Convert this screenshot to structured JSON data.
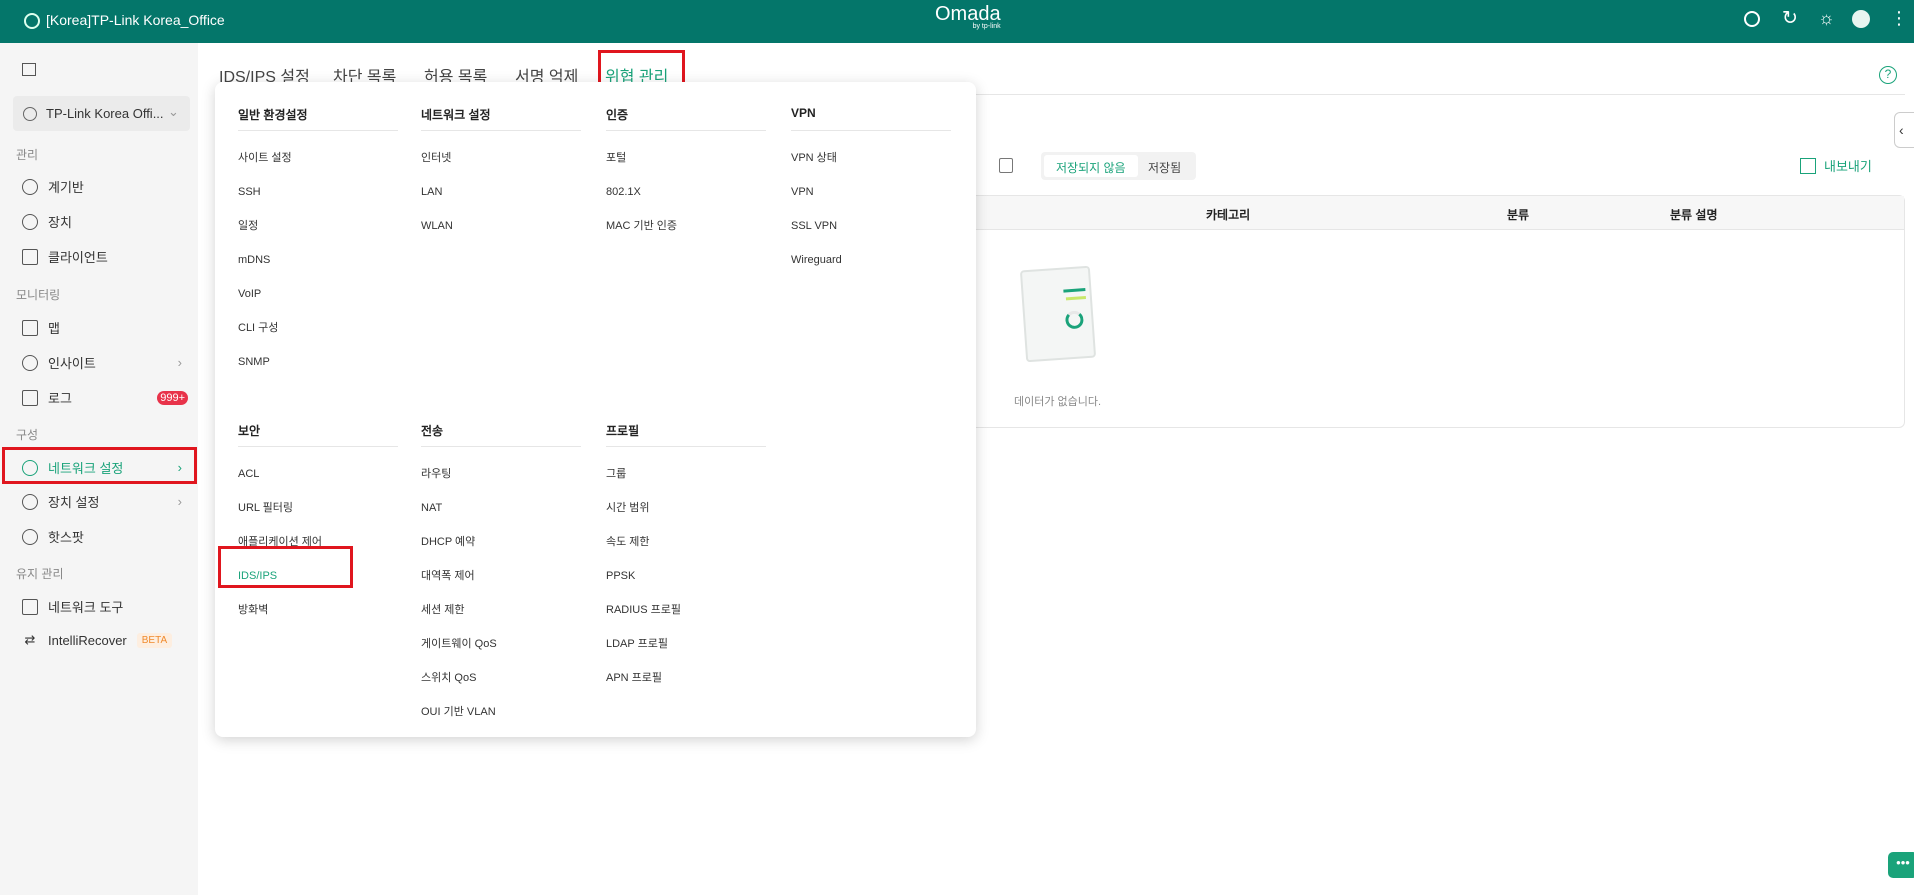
{
  "header": {
    "site_title": "[Korea]TP-Link Korea_Office",
    "logo": "Omada",
    "logo_sub": "by tp-link",
    "icons": [
      "search-icon",
      "refresh-icon",
      "theme-icon",
      "avatar",
      "more-icon"
    ]
  },
  "sidebar": {
    "site_selector": "TP-Link Korea Offi...",
    "sections": [
      {
        "label": "관리",
        "items": [
          {
            "label": "계기반",
            "icon": "dashboard-icon"
          },
          {
            "label": "장치",
            "icon": "device-icon"
          },
          {
            "label": "클라이언트",
            "icon": "client-icon"
          }
        ]
      },
      {
        "label": "모니터링",
        "items": [
          {
            "label": "맵",
            "icon": "map-icon"
          },
          {
            "label": "인사이트",
            "icon": "insight-icon"
          },
          {
            "label": "로그",
            "icon": "log-icon",
            "badge": "999+"
          }
        ]
      },
      {
        "label": "구성",
        "items": [
          {
            "label": "네트워크 설정",
            "icon": "globe-icon",
            "active": true
          },
          {
            "label": "장치 설정",
            "icon": "device-settings-icon"
          },
          {
            "label": "핫스팟",
            "icon": "hotspot-icon"
          }
        ]
      },
      {
        "label": "유지 관리",
        "items": [
          {
            "label": "네트워크 도구",
            "icon": "toolbox-icon"
          },
          {
            "label": "IntelliRecover",
            "icon": "recover-icon",
            "badge": "BETA"
          }
        ]
      }
    ]
  },
  "tabs": [
    {
      "label": "IDS/IPS 설정"
    },
    {
      "label": "차단 목록"
    },
    {
      "label": "허용 목록"
    },
    {
      "label": "서명 억제"
    },
    {
      "label": "위협 관리",
      "active": true
    }
  ],
  "menu": {
    "columns": [
      {
        "title": "일반 환경설정",
        "items": [
          "사이트 설정",
          "SSH",
          "일정",
          "mDNS",
          "VoIP",
          "CLI 구성",
          "SNMP"
        ]
      },
      {
        "title": "네트워크 설정",
        "items": [
          "인터넷",
          "LAN",
          "WLAN"
        ]
      },
      {
        "title": "인증",
        "items": [
          "포털",
          "802.1X",
          "MAC 기반 인증"
        ]
      },
      {
        "title": "VPN",
        "items": [
          "VPN 상태",
          "VPN",
          "SSL VPN",
          "Wireguard"
        ]
      },
      {
        "title": "보안",
        "items": [
          "ACL",
          "URL 필터링",
          "애플리케이션 제어",
          "IDS/IPS",
          "방화벽"
        ]
      },
      {
        "title": "전송",
        "items": [
          "라우팅",
          "NAT",
          "DHCP 예약",
          "대역폭 제어",
          "세션 제한",
          "게이트웨이 QoS",
          "스위치 QoS",
          "OUI 기반 VLAN"
        ]
      },
      {
        "title": "프로필",
        "items": [
          "그룹",
          "시간 범위",
          "속도 제한",
          "PPSK",
          "RADIUS 프로필",
          "LDAP 프로필",
          "APN 프로필"
        ]
      }
    ]
  },
  "content": {
    "segment": [
      "저장되지 않음",
      "저장됨"
    ],
    "export": "내보내기",
    "columns": [
      "카테고리",
      "분류",
      "분류 설명"
    ],
    "empty": "데이터가 없습니다."
  },
  "colors": {
    "brand": "#04766a",
    "accent": "#1aa37a",
    "badge": "#e8334a",
    "highlight": "#e0161e"
  }
}
